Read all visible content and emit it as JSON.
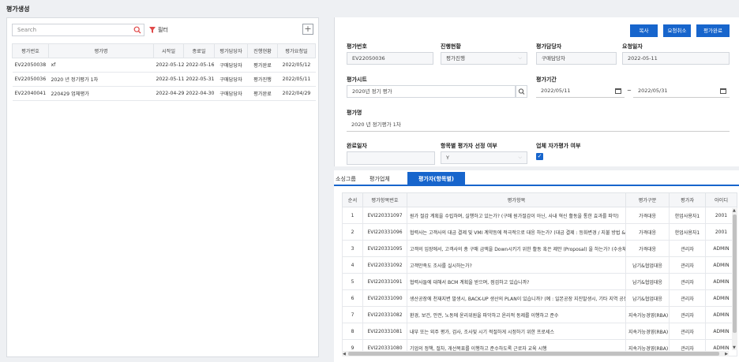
{
  "page": {
    "title": "평가생성"
  },
  "left": {
    "search_placeholder": "Search",
    "filter_label": "필터",
    "add_label": "+",
    "columns": [
      "평가번호",
      "평가명",
      "시작일",
      "종료일",
      "평가담당자",
      "진행현황",
      "평가요청일"
    ],
    "rows": [
      [
        "EV22050038",
        "xf",
        "2022-05-12",
        "2022-05-16",
        "구매담당자",
        "평가완료",
        "2022/05/12"
      ],
      [
        "EV22050036",
        "2020 년 정기평가 1차",
        "2022-05-11",
        "2022-05-31",
        "구매담당자",
        "평가진행",
        "2022/05/11"
      ],
      [
        "EV22040041",
        "220429 업체평가",
        "2022-04-29",
        "2022-04-30",
        "구매담당자",
        "평가완료",
        "2022/04/29"
      ]
    ]
  },
  "buttons": {
    "copy": "복사",
    "cancel_request": "요청취소",
    "complete": "평가완료"
  },
  "form": {
    "eval_no_label": "평가번호",
    "eval_no": "EV22050036",
    "status_label": "진행현황",
    "status": "평가진행",
    "manager_label": "평가담당자",
    "manager": "구매담당자",
    "request_date_label": "요청일자",
    "request_date": "2022-05-11",
    "sheet_label": "평가시트",
    "sheet": "2020년 정기 평가",
    "period_label": "평가기간",
    "period_start": "2022/05/11",
    "period_sep": "~",
    "period_end": "2022/05/31",
    "name_label": "평가명",
    "name": "2020 년 정기평가 1차",
    "done_date_label": "완료일자",
    "done_date": "",
    "item_select_label": "항목별 평가자 선정 여부",
    "item_select": "Y",
    "self_eval_label": "업체 자가평가 여부"
  },
  "tabs": [
    "소싱그룹",
    "평가업체",
    "평가자(항목별)"
  ],
  "items": {
    "columns": [
      "순서",
      "평가항목번호",
      "평가항목",
      "평가구분",
      "평가자",
      "아이디"
    ],
    "rows": [
      [
        "1",
        "EVI220331097",
        "원가 절감 계획을 수립하며, 실행하고 있는가? (구매 원가절감이 아닌, 사내 혁신 활동을 통한 효과를 파악)",
        "가격대응",
        "한업사용자1",
        "2001"
      ],
      [
        "2",
        "EVI220331096",
        "협력사는 고객사의 대금 결제 및 VMI 계약등에 적극적으로 대응 하는가? (대금 결제 : 등화변경 / 지불 방법 &",
        "가격대응",
        "한업사용자1",
        "2001"
      ],
      [
        "3",
        "EVI220331095",
        "고객의 입장에서, 고객사의 총 구매 금액을 Down시키기 위한 활동 혹은 제안 (Proposal) 을 하는가? (수송체",
        "가격대응",
        "관리자",
        "ADMIN"
      ],
      [
        "4",
        "EVI220331092",
        "고객만족도 조사를 실시하는가?",
        "납기&협업대응",
        "관리자",
        "ADMIN"
      ],
      [
        "5",
        "EVI220331091",
        "협력사들에 대해서 BCM 계획을 받으며, 점검하고 있습니까?",
        "납기&협업대응",
        "관리자",
        "ADMIN"
      ],
      [
        "6",
        "EVI220331090",
        "생산공장에 천재지변 발생시, BACK-UP 생산의 PLAN이 있습니까? (예 : 일본공장 지진발생시, 기타 지역 공장",
        "납기&협업대응",
        "관리자",
        "ADMIN"
      ],
      [
        "7",
        "EVI220331082",
        "환경, 보건, 안전, 노동에 윤리위원을 파악하고 윤리적 동제를 이행하고 준수",
        "지속가능경영(RBA)",
        "관리자",
        "ADMIN"
      ],
      [
        "8",
        "EVI220331081",
        "내부 또는 외주 평가, 검사, 조사및 시기 적절하게 시정하기 위한 프로세스",
        "지속가능경영(RBA)",
        "관리자",
        "ADMIN"
      ],
      [
        "9",
        "EVI220331080",
        "기업의 정책, 절차, 개선목표를 이행하고 준수하도록 근로자 교육 시행",
        "지속가능경영(RBA)",
        "관리자",
        "ADMIN"
      ]
    ]
  }
}
